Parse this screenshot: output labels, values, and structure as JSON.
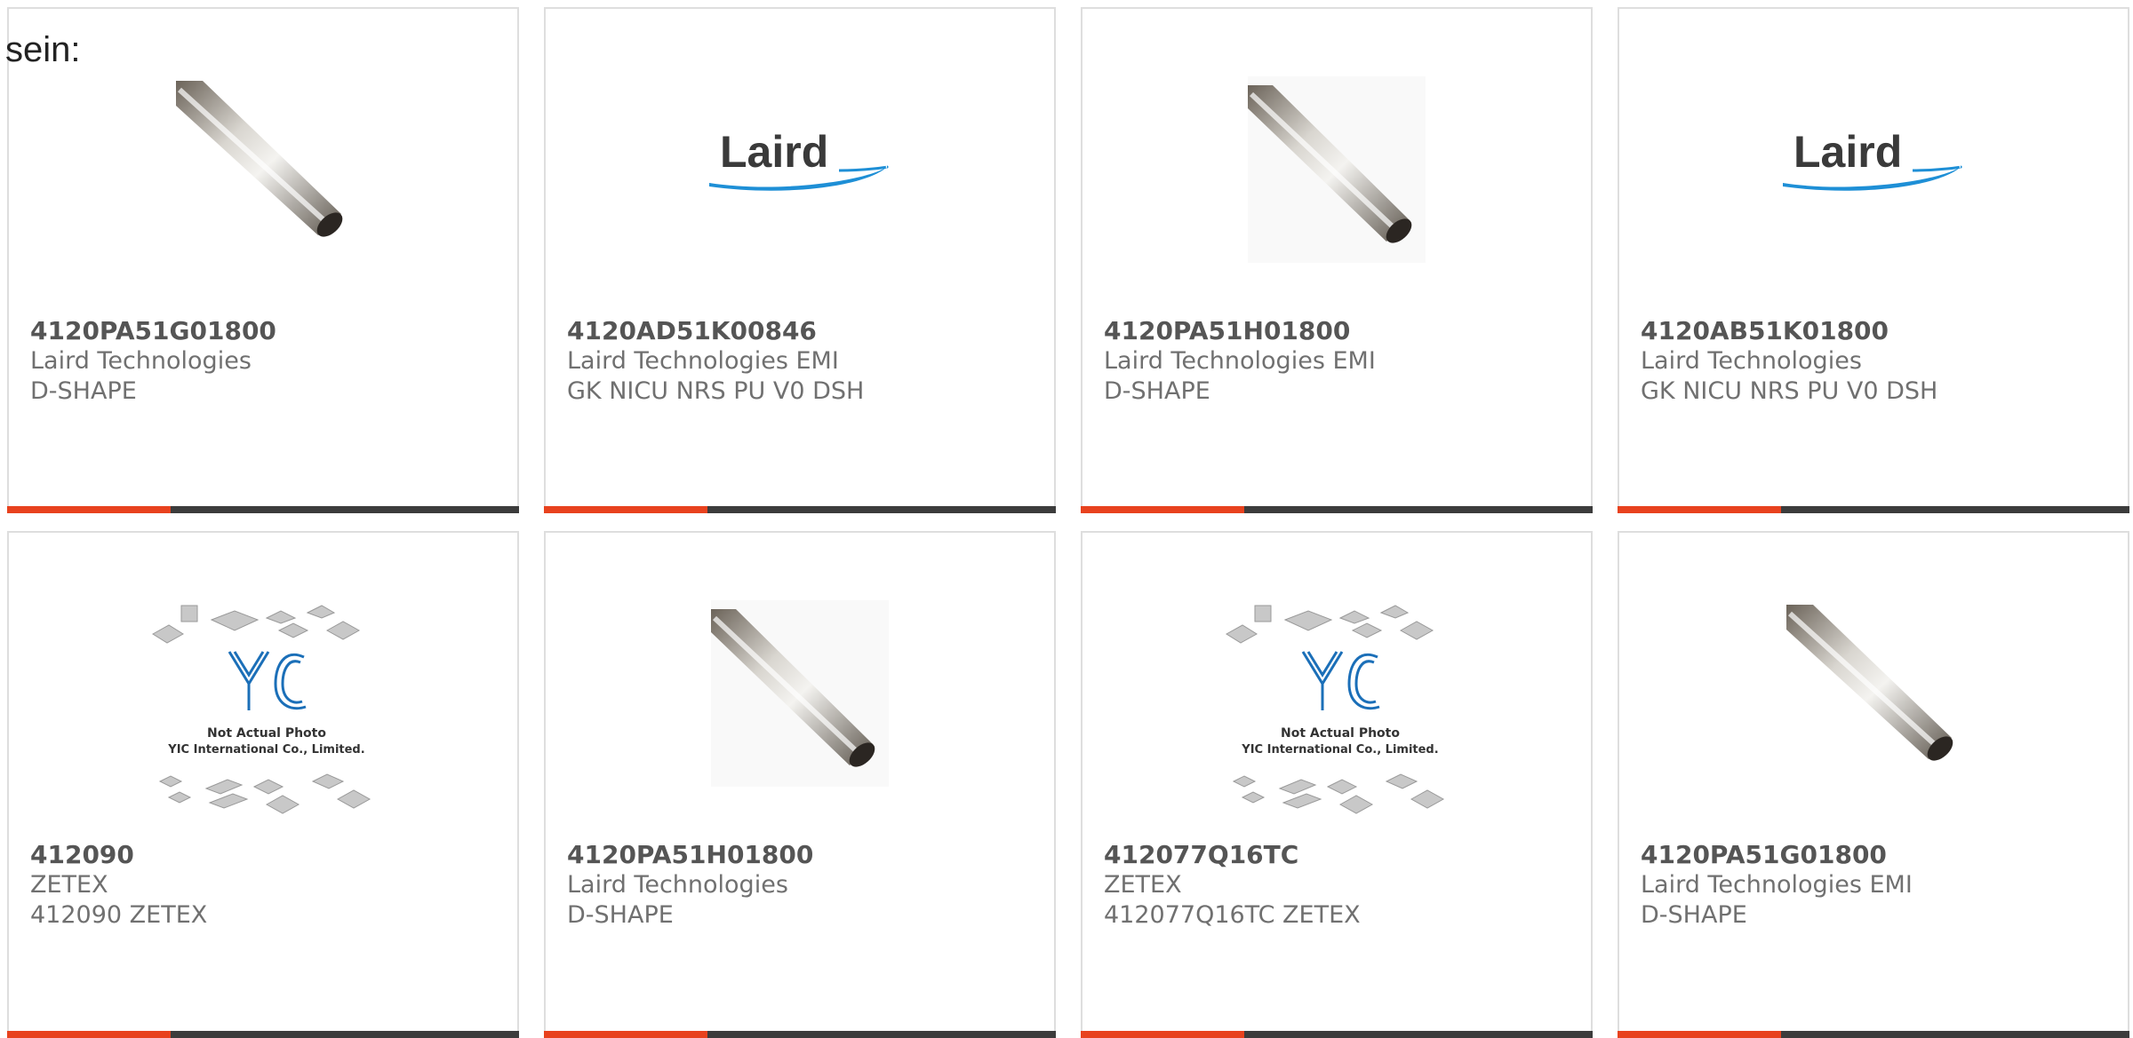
{
  "lead_text": "sein:",
  "colors": {
    "accent": "#e8421e",
    "bar": "#3c3c3c",
    "laird_blue": "#1e8fd6",
    "yic_blue": "#1b6fb8"
  },
  "products": [
    {
      "part_number": "4120PA51G01800",
      "manufacturer": "Laird Technologies",
      "description": "D-SHAPE",
      "image": "tube-photo"
    },
    {
      "part_number": "4120AD51K00846",
      "manufacturer": "Laird Technologies EMI",
      "description": "GK NICU NRS PU V0 DSH",
      "image": "laird-logo",
      "logo_text": "Laird"
    },
    {
      "part_number": "4120PA51H01800",
      "manufacturer": "Laird Technologies EMI",
      "description": "D-SHAPE",
      "image": "tube-photo"
    },
    {
      "part_number": "4120AB51K01800",
      "manufacturer": "Laird Technologies",
      "description": "GK NICU NRS PU V0 DSH",
      "image": "laird-logo",
      "logo_text": "Laird"
    },
    {
      "part_number": "412090",
      "manufacturer": "ZETEX",
      "description": "412090 ZETEX",
      "image": "yic-placeholder",
      "placeholder_lines": [
        "Not Actual Photo",
        "YIC International Co., Limited."
      ]
    },
    {
      "part_number": "4120PA51H01800",
      "manufacturer": "Laird Technologies",
      "description": "D-SHAPE",
      "image": "tube-photo"
    },
    {
      "part_number": "412077Q16TC",
      "manufacturer": "ZETEX",
      "description": "412077Q16TC ZETEX",
      "image": "yic-placeholder",
      "placeholder_lines": [
        "Not Actual Photo",
        "YIC International Co., Limited."
      ]
    },
    {
      "part_number": "4120PA51G01800",
      "manufacturer": "Laird Technologies EMI",
      "description": "D-SHAPE",
      "image": "tube-photo"
    }
  ]
}
